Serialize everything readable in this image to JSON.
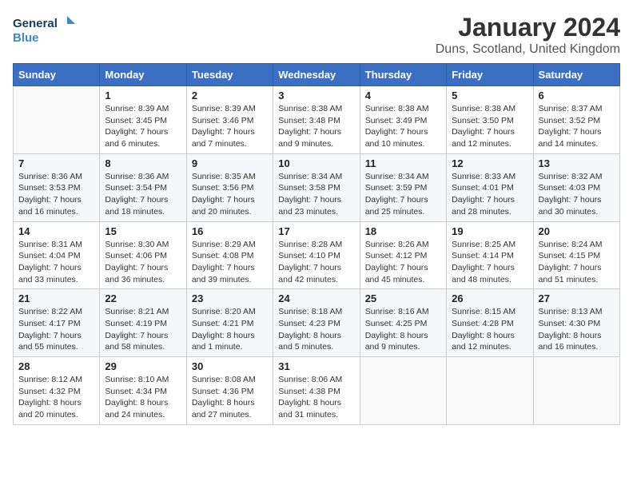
{
  "header": {
    "logo_line1": "General",
    "logo_line2": "Blue",
    "month": "January 2024",
    "location": "Duns, Scotland, United Kingdom"
  },
  "days_of_week": [
    "Sunday",
    "Monday",
    "Tuesday",
    "Wednesday",
    "Thursday",
    "Friday",
    "Saturday"
  ],
  "weeks": [
    [
      {
        "day": "",
        "sunrise": "",
        "sunset": "",
        "daylight": ""
      },
      {
        "day": "1",
        "sunrise": "Sunrise: 8:39 AM",
        "sunset": "Sunset: 3:45 PM",
        "daylight": "Daylight: 7 hours and 6 minutes."
      },
      {
        "day": "2",
        "sunrise": "Sunrise: 8:39 AM",
        "sunset": "Sunset: 3:46 PM",
        "daylight": "Daylight: 7 hours and 7 minutes."
      },
      {
        "day": "3",
        "sunrise": "Sunrise: 8:38 AM",
        "sunset": "Sunset: 3:48 PM",
        "daylight": "Daylight: 7 hours and 9 minutes."
      },
      {
        "day": "4",
        "sunrise": "Sunrise: 8:38 AM",
        "sunset": "Sunset: 3:49 PM",
        "daylight": "Daylight: 7 hours and 10 minutes."
      },
      {
        "day": "5",
        "sunrise": "Sunrise: 8:38 AM",
        "sunset": "Sunset: 3:50 PM",
        "daylight": "Daylight: 7 hours and 12 minutes."
      },
      {
        "day": "6",
        "sunrise": "Sunrise: 8:37 AM",
        "sunset": "Sunset: 3:52 PM",
        "daylight": "Daylight: 7 hours and 14 minutes."
      }
    ],
    [
      {
        "day": "7",
        "sunrise": "Sunrise: 8:36 AM",
        "sunset": "Sunset: 3:53 PM",
        "daylight": "Daylight: 7 hours and 16 minutes."
      },
      {
        "day": "8",
        "sunrise": "Sunrise: 8:36 AM",
        "sunset": "Sunset: 3:54 PM",
        "daylight": "Daylight: 7 hours and 18 minutes."
      },
      {
        "day": "9",
        "sunrise": "Sunrise: 8:35 AM",
        "sunset": "Sunset: 3:56 PM",
        "daylight": "Daylight: 7 hours and 20 minutes."
      },
      {
        "day": "10",
        "sunrise": "Sunrise: 8:34 AM",
        "sunset": "Sunset: 3:58 PM",
        "daylight": "Daylight: 7 hours and 23 minutes."
      },
      {
        "day": "11",
        "sunrise": "Sunrise: 8:34 AM",
        "sunset": "Sunset: 3:59 PM",
        "daylight": "Daylight: 7 hours and 25 minutes."
      },
      {
        "day": "12",
        "sunrise": "Sunrise: 8:33 AM",
        "sunset": "Sunset: 4:01 PM",
        "daylight": "Daylight: 7 hours and 28 minutes."
      },
      {
        "day": "13",
        "sunrise": "Sunrise: 8:32 AM",
        "sunset": "Sunset: 4:03 PM",
        "daylight": "Daylight: 7 hours and 30 minutes."
      }
    ],
    [
      {
        "day": "14",
        "sunrise": "Sunrise: 8:31 AM",
        "sunset": "Sunset: 4:04 PM",
        "daylight": "Daylight: 7 hours and 33 minutes."
      },
      {
        "day": "15",
        "sunrise": "Sunrise: 8:30 AM",
        "sunset": "Sunset: 4:06 PM",
        "daylight": "Daylight: 7 hours and 36 minutes."
      },
      {
        "day": "16",
        "sunrise": "Sunrise: 8:29 AM",
        "sunset": "Sunset: 4:08 PM",
        "daylight": "Daylight: 7 hours and 39 minutes."
      },
      {
        "day": "17",
        "sunrise": "Sunrise: 8:28 AM",
        "sunset": "Sunset: 4:10 PM",
        "daylight": "Daylight: 7 hours and 42 minutes."
      },
      {
        "day": "18",
        "sunrise": "Sunrise: 8:26 AM",
        "sunset": "Sunset: 4:12 PM",
        "daylight": "Daylight: 7 hours and 45 minutes."
      },
      {
        "day": "19",
        "sunrise": "Sunrise: 8:25 AM",
        "sunset": "Sunset: 4:14 PM",
        "daylight": "Daylight: 7 hours and 48 minutes."
      },
      {
        "day": "20",
        "sunrise": "Sunrise: 8:24 AM",
        "sunset": "Sunset: 4:15 PM",
        "daylight": "Daylight: 7 hours and 51 minutes."
      }
    ],
    [
      {
        "day": "21",
        "sunrise": "Sunrise: 8:22 AM",
        "sunset": "Sunset: 4:17 PM",
        "daylight": "Daylight: 7 hours and 55 minutes."
      },
      {
        "day": "22",
        "sunrise": "Sunrise: 8:21 AM",
        "sunset": "Sunset: 4:19 PM",
        "daylight": "Daylight: 7 hours and 58 minutes."
      },
      {
        "day": "23",
        "sunrise": "Sunrise: 8:20 AM",
        "sunset": "Sunset: 4:21 PM",
        "daylight": "Daylight: 8 hours and 1 minute."
      },
      {
        "day": "24",
        "sunrise": "Sunrise: 8:18 AM",
        "sunset": "Sunset: 4:23 PM",
        "daylight": "Daylight: 8 hours and 5 minutes."
      },
      {
        "day": "25",
        "sunrise": "Sunrise: 8:16 AM",
        "sunset": "Sunset: 4:25 PM",
        "daylight": "Daylight: 8 hours and 9 minutes."
      },
      {
        "day": "26",
        "sunrise": "Sunrise: 8:15 AM",
        "sunset": "Sunset: 4:28 PM",
        "daylight": "Daylight: 8 hours and 12 minutes."
      },
      {
        "day": "27",
        "sunrise": "Sunrise: 8:13 AM",
        "sunset": "Sunset: 4:30 PM",
        "daylight": "Daylight: 8 hours and 16 minutes."
      }
    ],
    [
      {
        "day": "28",
        "sunrise": "Sunrise: 8:12 AM",
        "sunset": "Sunset: 4:32 PM",
        "daylight": "Daylight: 8 hours and 20 minutes."
      },
      {
        "day": "29",
        "sunrise": "Sunrise: 8:10 AM",
        "sunset": "Sunset: 4:34 PM",
        "daylight": "Daylight: 8 hours and 24 minutes."
      },
      {
        "day": "30",
        "sunrise": "Sunrise: 8:08 AM",
        "sunset": "Sunset: 4:36 PM",
        "daylight": "Daylight: 8 hours and 27 minutes."
      },
      {
        "day": "31",
        "sunrise": "Sunrise: 8:06 AM",
        "sunset": "Sunset: 4:38 PM",
        "daylight": "Daylight: 8 hours and 31 minutes."
      },
      {
        "day": "",
        "sunrise": "",
        "sunset": "",
        "daylight": ""
      },
      {
        "day": "",
        "sunrise": "",
        "sunset": "",
        "daylight": ""
      },
      {
        "day": "",
        "sunrise": "",
        "sunset": "",
        "daylight": ""
      }
    ]
  ]
}
